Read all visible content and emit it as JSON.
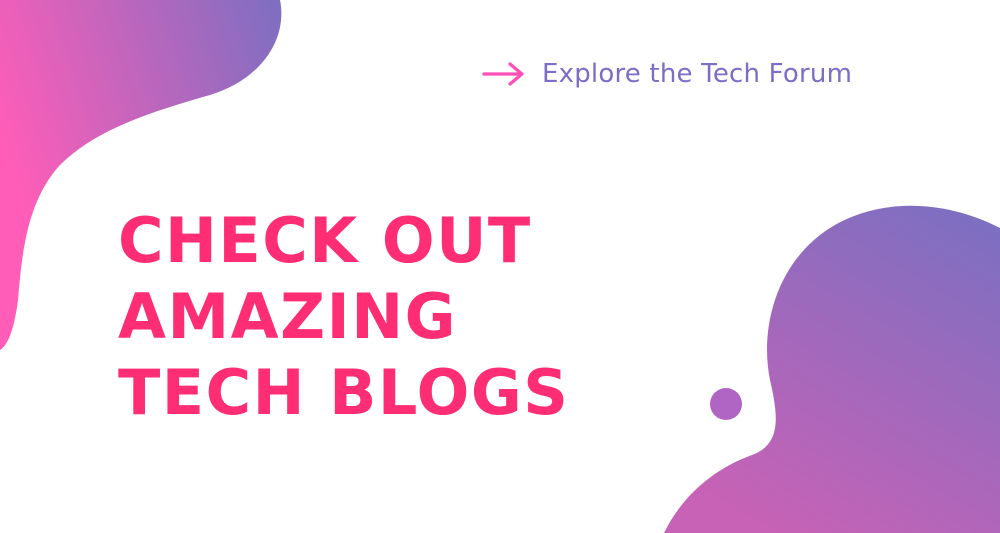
{
  "link": {
    "label": "Explore the Tech Forum"
  },
  "headline": {
    "lines": [
      "CHECK OUT",
      "AMAZING",
      "TECH BLOGS"
    ]
  },
  "colors": {
    "headline": "#ff2d74",
    "link_text": "#7b6ec6",
    "arrow": "#ff4fb6",
    "gradient_pink": "#ff5db8",
    "gradient_purple": "#7c6fc1",
    "dot": "#b065c5"
  },
  "icons": {
    "link_icon": "arrow-right-icon"
  }
}
